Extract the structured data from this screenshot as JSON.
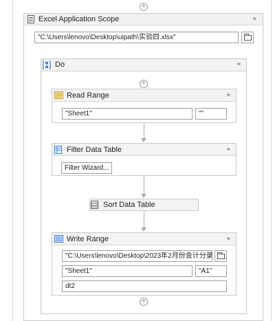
{
  "canvas": {
    "top_add_icon": "plus-circle",
    "bottom_add_icon": "plus-circle"
  },
  "excel_scope": {
    "title": "Excel Application Scope",
    "icon": "excel-scope-icon",
    "collapse_glyph": "≈",
    "workbook_path": "\"C:\\Users\\lenovo\\Desktop\\uipath\\实验四.xlsx\"",
    "browse_icon": "folder-icon"
  },
  "do": {
    "title": "Do",
    "icon": "sequence-icon",
    "collapse_glyph": "≈"
  },
  "read_range": {
    "title": "Read Range",
    "icon": "read-range-icon",
    "collapse_glyph": "≈",
    "sheet": "\"Sheet1\"",
    "range": "\"\""
  },
  "filter_data_table": {
    "title": "Filter Data Table",
    "icon": "filter-table-icon",
    "collapse_glyph": "≈",
    "wizard_label": "Filter Wizard..."
  },
  "sort_data_table": {
    "title": "Sort Data Table",
    "icon": "sort-table-icon"
  },
  "write_range": {
    "title": "Write Range",
    "icon": "write-range-icon",
    "collapse_glyph": "≈",
    "workbook_path": "\"C:\\Users\\lenovo\\Desktop\\2023年2月份会计分录",
    "sheet": "\"Sheet1\"",
    "start_cell": "\"A1\"",
    "data_table": "dt2",
    "browse_icon": "folder-icon"
  },
  "colors": {
    "header_bg": "#f1f1f1",
    "border": "#c9c9c9",
    "connector": "#a9a9a9",
    "read_icon": "#d9b44a",
    "table_icon": "#3a7bd5"
  }
}
